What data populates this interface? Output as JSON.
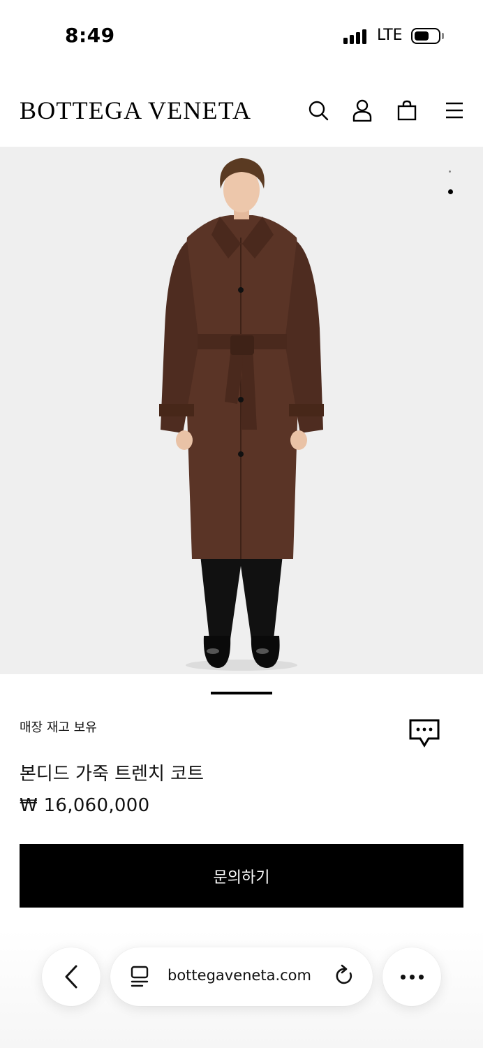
{
  "status_bar": {
    "time": "8:49",
    "network": "LTE"
  },
  "header": {
    "brand": "BOTTEGA VENETA",
    "icons": [
      "search-icon",
      "account-icon",
      "bag-icon",
      "menu-icon"
    ]
  },
  "gallery": {
    "image": "model-in-brown-leather-trench-coat",
    "current_slide": 2,
    "total_slides": 2
  },
  "product": {
    "availability": "매장 재고 보유",
    "title": "본디드 가죽 트렌치 코트",
    "price": "₩ 16,060,000",
    "cta_label": "문의하기"
  },
  "browser": {
    "url": "bottegaveneta.com",
    "icons": [
      "back-icon",
      "tabs-icon",
      "reload-icon",
      "more-icon"
    ]
  },
  "colors": {
    "brand_black": "#000000",
    "gallery_bg": "#efefef",
    "coat_brown": "#5a3426"
  }
}
